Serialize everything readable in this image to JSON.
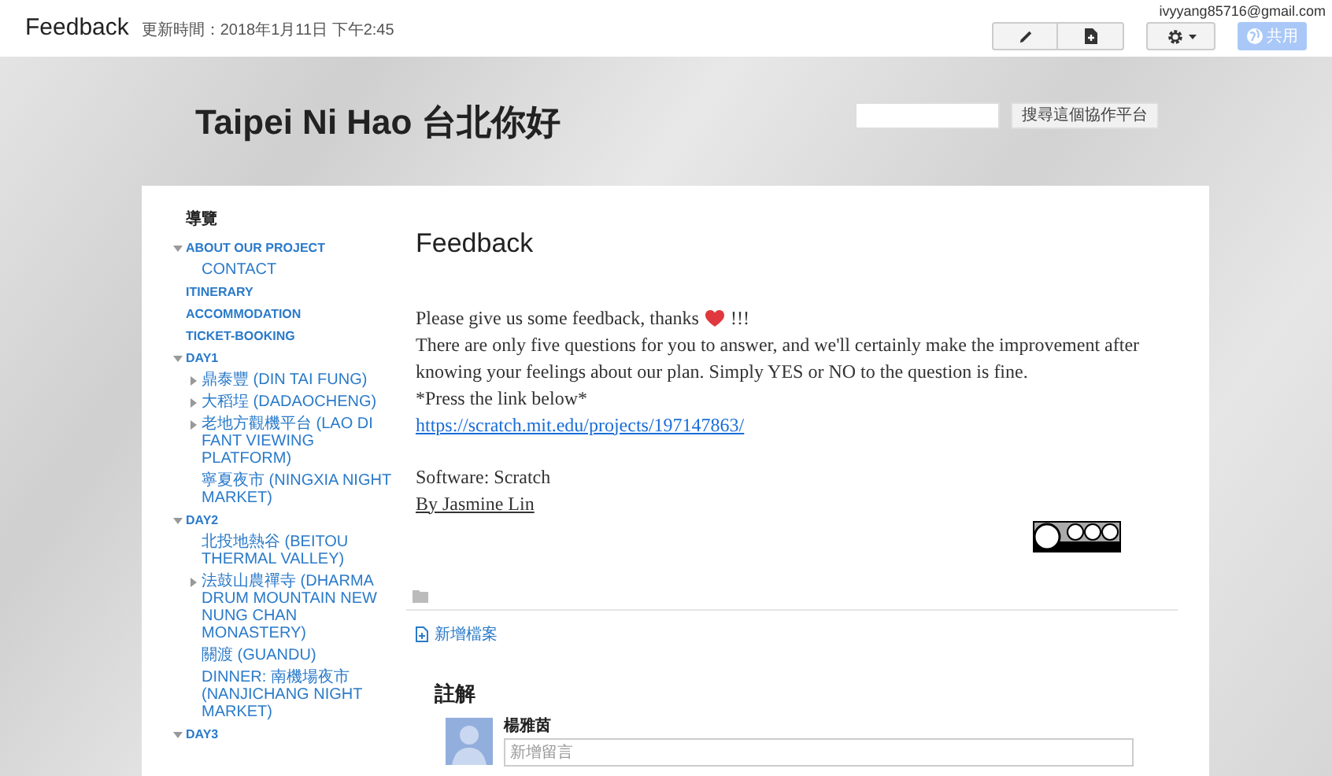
{
  "topbar": {
    "title": "Feedback",
    "updated": "更新時間：2018年1月11日 下午2:45",
    "account": "ivyyang85716@gmail.com",
    "share_label": "共用"
  },
  "site": {
    "title": "Taipei Ni Hao 台北你好",
    "search_button": "搜尋這個協作平台"
  },
  "nav": {
    "heading": "導覽",
    "items": [
      {
        "label": "ABOUT OUR PROJECT",
        "expanded": true,
        "children": [
          {
            "label": "CONTACT"
          }
        ]
      },
      {
        "label": "ITINERARY"
      },
      {
        "label": "ACCOMMODATION"
      },
      {
        "label": "TICKET-BOOKING"
      },
      {
        "label": "DAY1",
        "expanded": true,
        "children": [
          {
            "label": "鼎泰豐 (DIN TAI FUNG)",
            "expanded": false
          },
          {
            "label": "大稻埕 (DADAOCHENG)",
            "expanded": false
          },
          {
            "label": "老地方觀機平台 (LAO DI FANT VIEWING PLATFORM)",
            "expanded": false
          },
          {
            "label": "寧夏夜市 (NINGXIA NIGHT MARKET)"
          }
        ]
      },
      {
        "label": "DAY2",
        "expanded": true,
        "children": [
          {
            "label": "北投地熱谷 (BEITOU THERMAL VALLEY)"
          },
          {
            "label": "法鼓山農禪寺 (DHARMA DRUM MOUNTAIN NEW NUNG CHAN MONASTERY)",
            "expanded": false
          },
          {
            "label": "關渡 (GUANDU)"
          },
          {
            "label": "DINNER: 南機場夜市 (NANJICHANG NIGHT MARKET)"
          }
        ]
      },
      {
        "label": "DAY3",
        "expanded": true
      }
    ]
  },
  "page": {
    "title": "Feedback",
    "body": [
      {
        "kind": "heart",
        "text": "Please give us some feedback, thanks",
        "after": "!!!"
      },
      {
        "kind": "text",
        "text": "There are only five questions for you to answer, and we'll certainly make the improvement after knowing your feelings about our plan. Simply YES or NO to the question is fine."
      },
      {
        "kind": "text",
        "text": "*Press the link below*"
      },
      {
        "kind": "link",
        "text": "https://scratch.mit.edu/projects/197147863/"
      },
      {
        "kind": "gap"
      },
      {
        "kind": "text",
        "text": "Software: Scratch"
      },
      {
        "kind": "underline",
        "text": "By Jasmine Lin"
      }
    ],
    "add_file": "新增檔案",
    "comments_title": "註解",
    "commenter": "楊雅茵",
    "comment_placeholder": "新增留言"
  }
}
